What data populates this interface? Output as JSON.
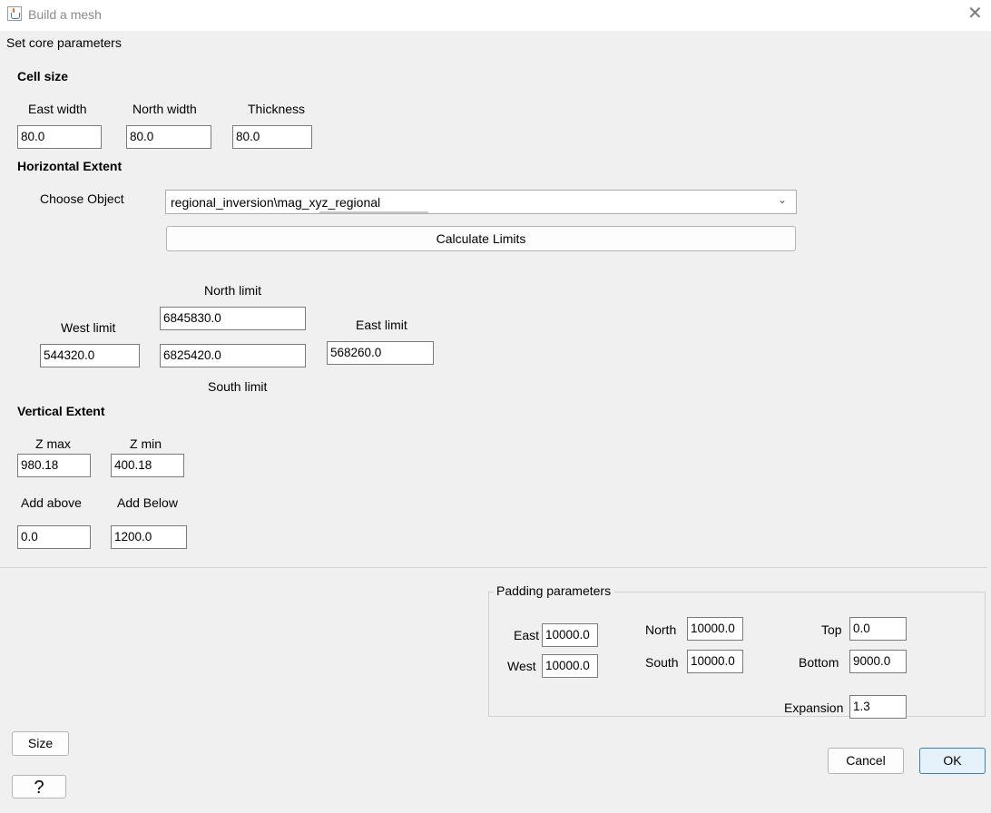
{
  "window": {
    "title": "Build a mesh",
    "close_glyph": "✕"
  },
  "core": {
    "legend": "Set core parameters",
    "cell_size": {
      "heading": "Cell size",
      "east_width_label": "East width",
      "east_width_value": "80.0",
      "north_width_label": "North width",
      "north_width_value": "80.0",
      "thickness_label": "Thickness",
      "thickness_value": "80.0"
    },
    "horizontal_extent": {
      "heading": "Horizontal Extent",
      "choose_object_label": "Choose Object",
      "choose_object_value": "regional_inversion\\mag_xyz_regional",
      "calculate_button": "Calculate Limits",
      "north_limit_label": "North limit",
      "north_limit_value": "6845830.0",
      "west_limit_label": "West limit",
      "west_limit_value": "544320.0",
      "south_limit_label": "South limit",
      "south_limit_value": "6825420.0",
      "east_limit_label": "East limit",
      "east_limit_value": "568260.0"
    },
    "vertical_extent": {
      "heading": "Vertical Extent",
      "zmax_label": "Z max",
      "zmax_value": "980.18",
      "zmin_label": "Z min",
      "zmin_value": "400.18",
      "add_above_label": "Add above",
      "add_above_value": "0.0",
      "add_below_label": "Add Below",
      "add_below_value": "1200.0"
    }
  },
  "padding": {
    "legend": "Padding parameters",
    "east_label": "East",
    "east_value": "10000.0",
    "west_label": "West",
    "west_value": "10000.0",
    "north_label": "North",
    "north_value": "10000.0",
    "south_label": "South",
    "south_value": "10000.0",
    "top_label": "Top",
    "top_value": "0.0",
    "bottom_label": "Bottom",
    "bottom_value": "9000.0",
    "expansion_label": "Expansion",
    "expansion_value": "1.3"
  },
  "buttons": {
    "size": "Size",
    "help": "?",
    "cancel": "Cancel",
    "ok": "OK"
  },
  "colors": {
    "background": "#f0f0f0",
    "ok_border": "#3c7fb1",
    "ok_fill": "#e5f1fb"
  }
}
